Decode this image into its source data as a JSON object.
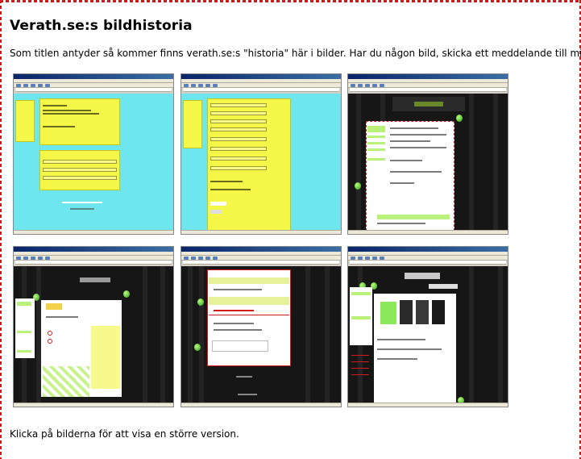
{
  "page": {
    "title": "Verath.se:s bildhistoria",
    "intro": "Som titlen antyder så kommer finns verath.se:s \"historia\" här i bilder. Har du någon bild, skicka ett meddelande till mig.",
    "footer": "Klicka på bilderna för att visa en större version."
  },
  "thumbnails": [
    {
      "name": "screenshot-1"
    },
    {
      "name": "screenshot-2"
    },
    {
      "name": "screenshot-3"
    },
    {
      "name": "screenshot-4"
    },
    {
      "name": "screenshot-5"
    },
    {
      "name": "screenshot-6"
    }
  ],
  "colors": {
    "border": "#cc1a1a",
    "cyan": "#6ee6ee",
    "yellow": "#f4f648",
    "lime": "#b9f27a",
    "dark": "#161616"
  }
}
